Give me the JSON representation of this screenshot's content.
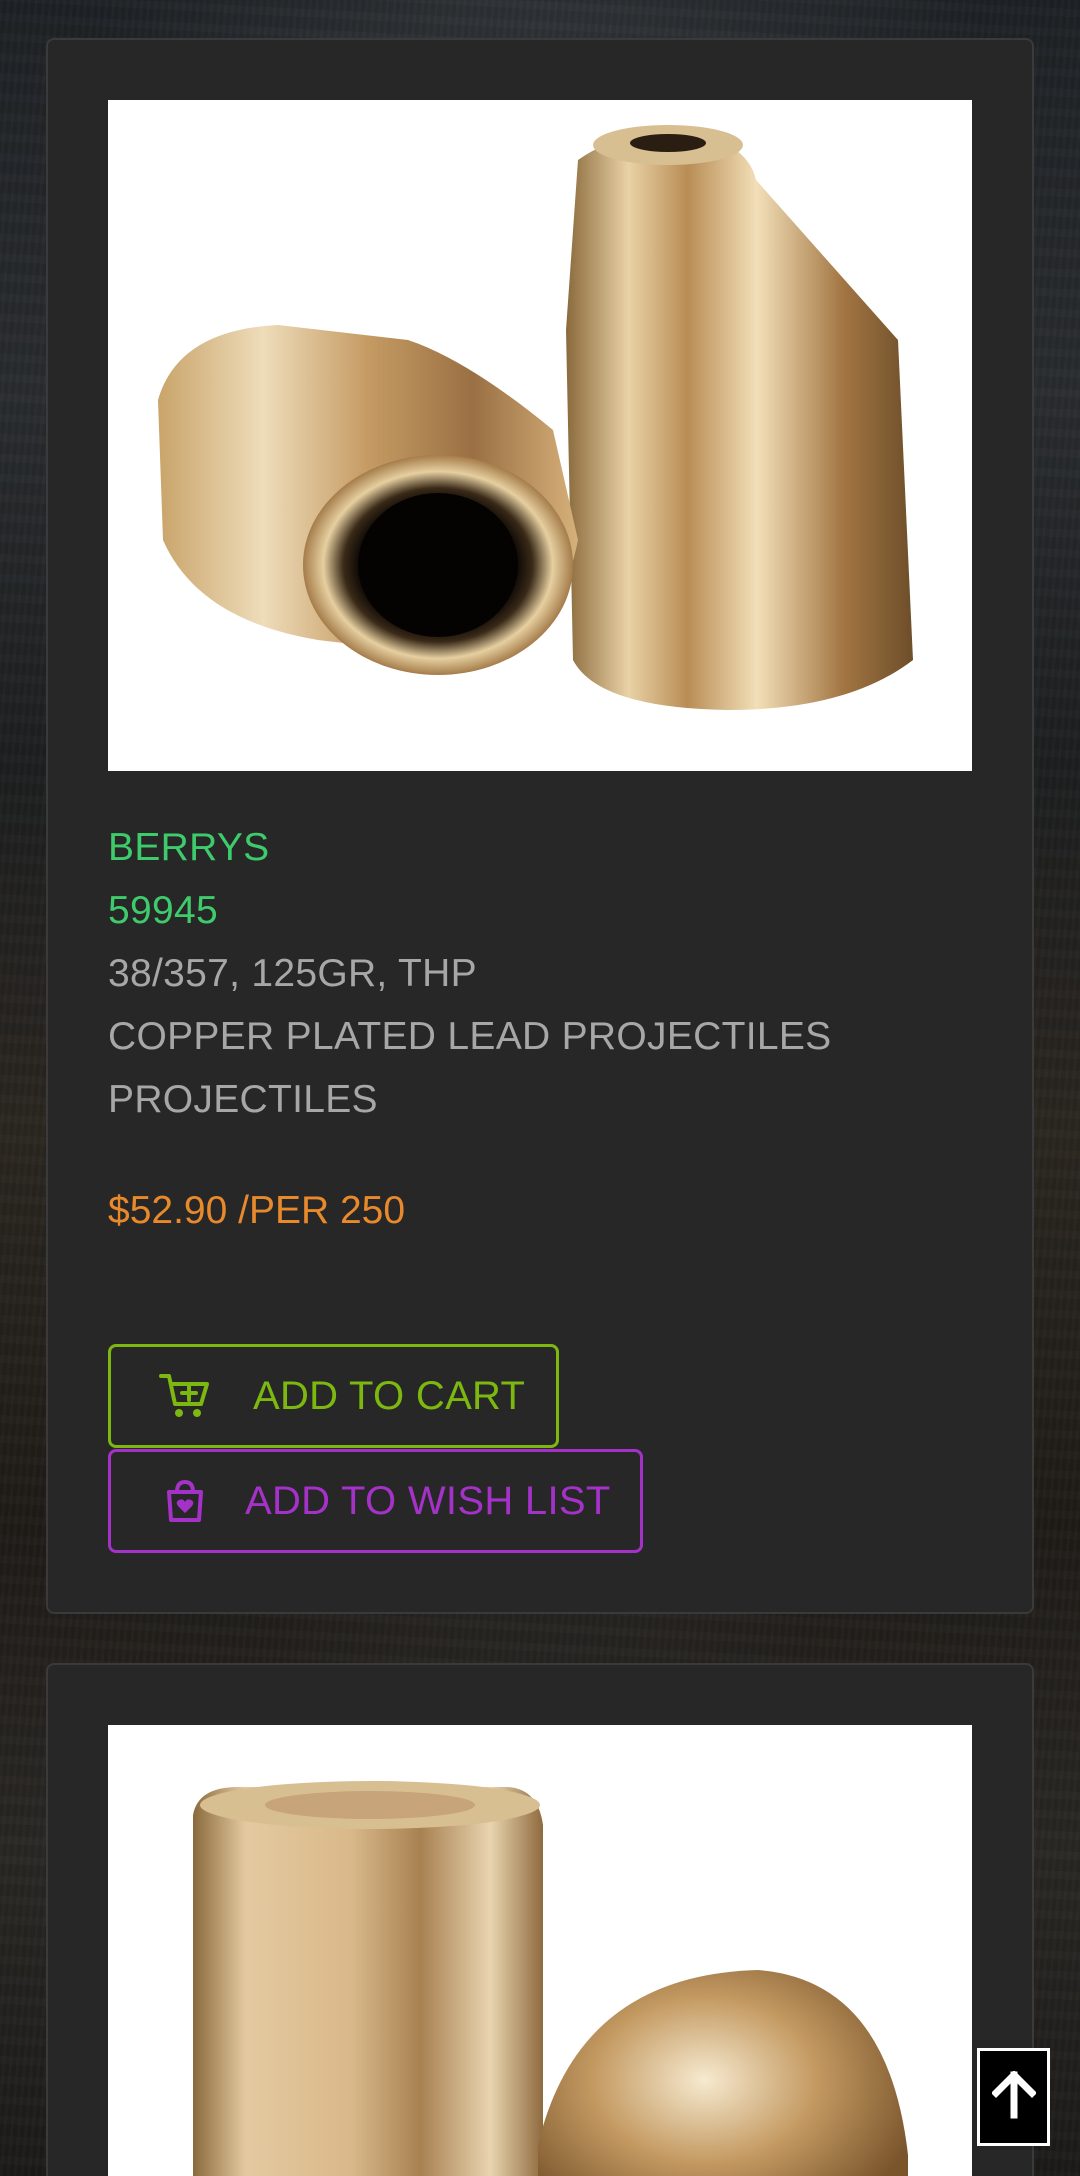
{
  "products": [
    {
      "brand": "BERRYS",
      "sku": "59945",
      "description_lines": [
        "38/357, 125GR, THP",
        "COPPER PLATED LEAD PROJECTILES",
        "PROJECTILES"
      ],
      "price": "$52.90 /PER 250",
      "image_icon": "hollow-point-bullets-image",
      "add_to_cart_label": "ADD TO CART",
      "add_to_wishlist_label": "ADD TO WISH LIST"
    },
    {
      "image_icon": "flat-point-bullets-image"
    }
  ],
  "colors": {
    "brand": "#3ecb6b",
    "description": "#a7a7a7",
    "price": "#e8892c",
    "cart": "#7cb80f",
    "wishlist": "#a432c8",
    "card": "#272727"
  },
  "icons": {
    "cart": "cart-plus-icon",
    "wishlist": "wish-bag-icon",
    "scroll_top": "arrow-up-icon"
  }
}
